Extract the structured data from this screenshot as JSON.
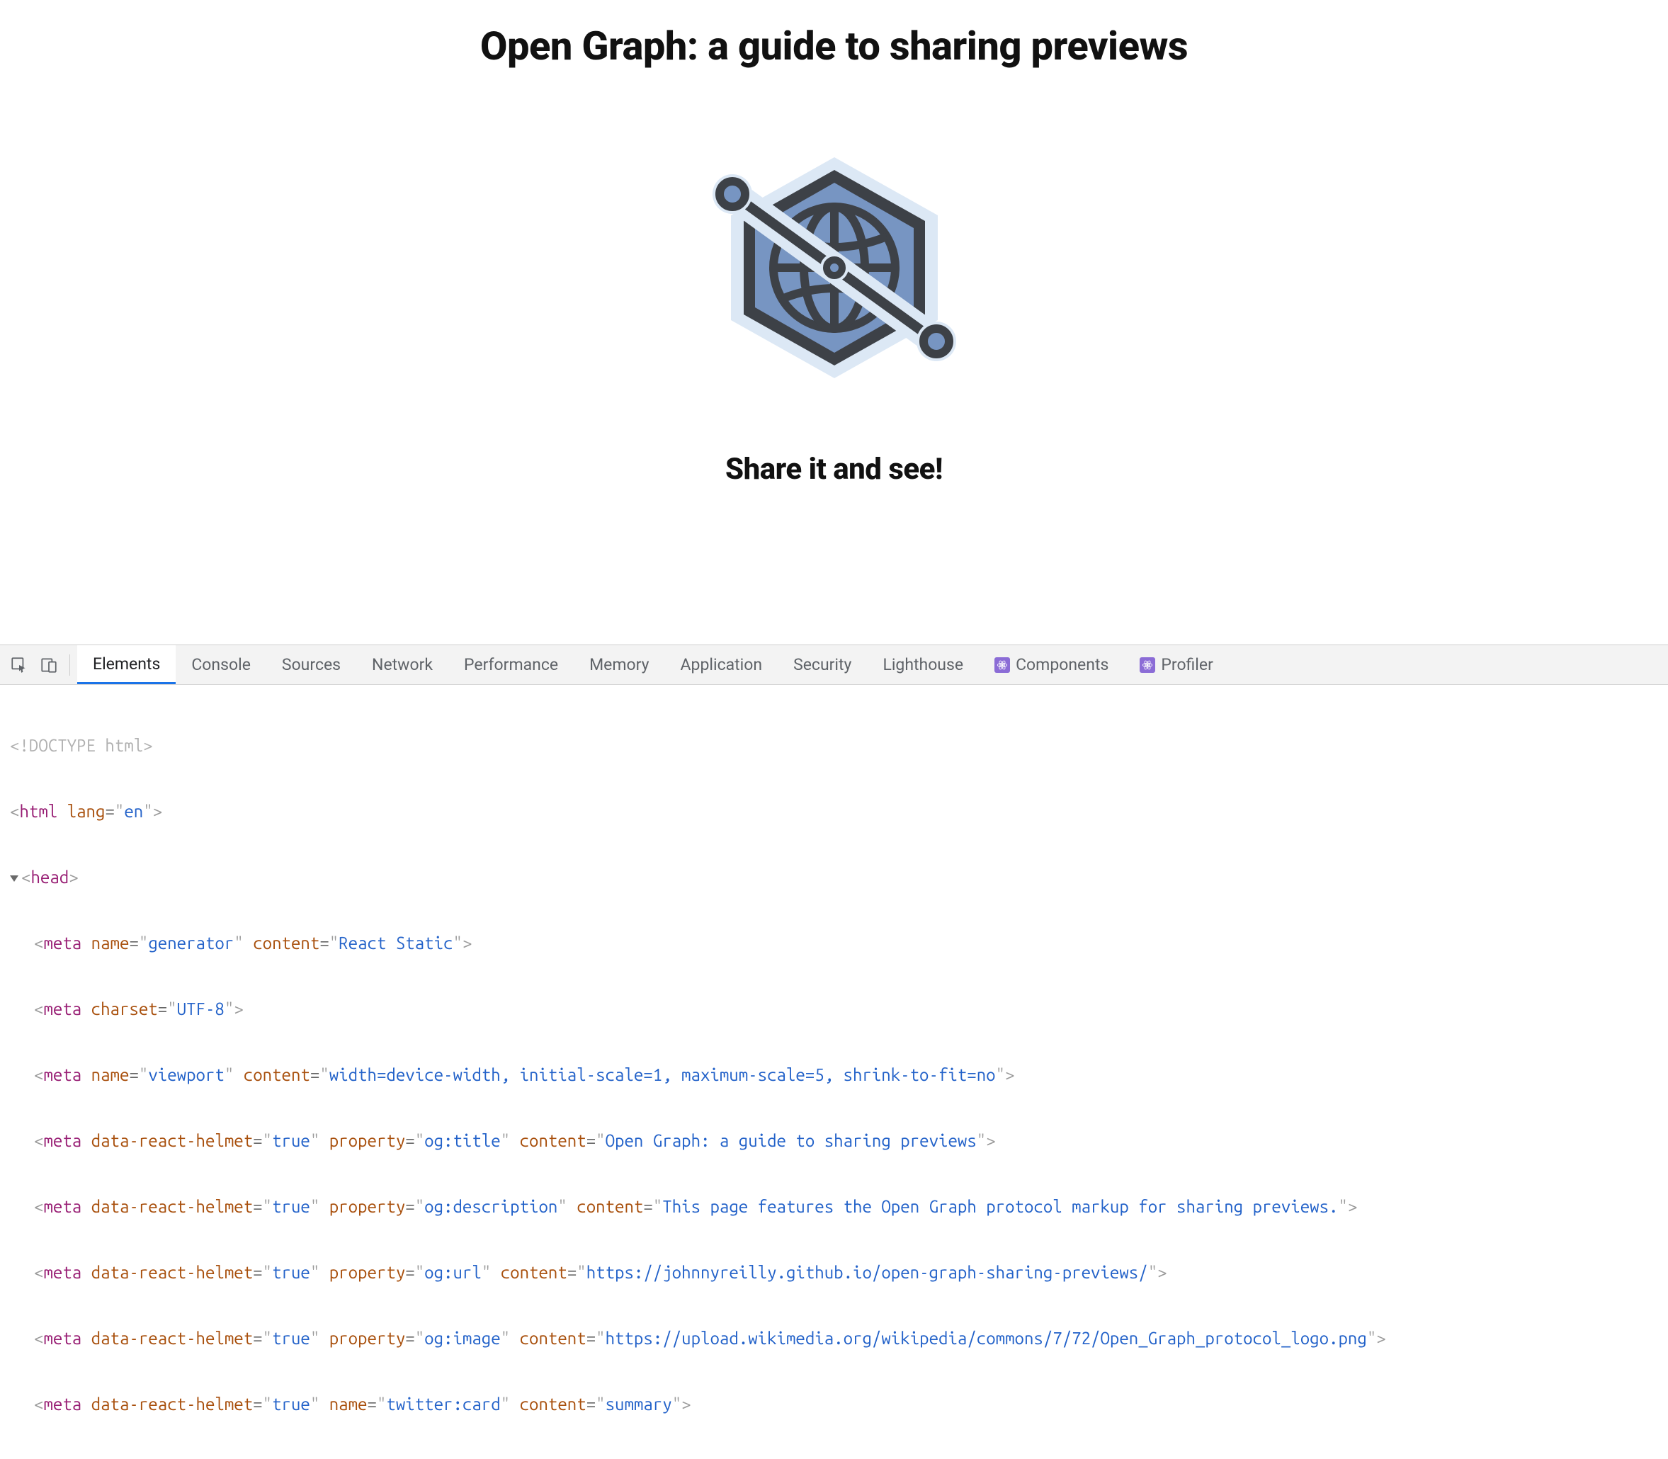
{
  "page": {
    "title": "Open Graph: a guide to sharing previews",
    "subtitle": "Share it and see!"
  },
  "devtools": {
    "tabs": [
      "Elements",
      "Console",
      "Sources",
      "Network",
      "Performance",
      "Memory",
      "Application",
      "Security",
      "Lighthouse",
      "Components",
      "Profiler"
    ],
    "active_tab": "Elements"
  },
  "dom": {
    "doctype": "<!DOCTYPE html>",
    "html_lang": "en",
    "meta": [
      {
        "kind": "name",
        "key": "generator",
        "value": "React Static"
      },
      {
        "kind": "charset",
        "value": "UTF-8"
      },
      {
        "kind": "name",
        "key": "viewport",
        "value": "width=device-width, initial-scale=1, maximum-scale=5, shrink-to-fit=no"
      },
      {
        "kind": "helmet-property",
        "key": "og:title",
        "value": "Open Graph: a guide to sharing previews"
      },
      {
        "kind": "helmet-property",
        "key": "og:description",
        "value": "This page features the Open Graph protocol markup for sharing previews."
      },
      {
        "kind": "helmet-property",
        "key": "og:url",
        "value": "https://johnnyreilly.github.io/open-graph-sharing-previews/"
      },
      {
        "kind": "helmet-property",
        "key": "og:image",
        "value": "https://upload.wikimedia.org/wikipedia/commons/7/72/Open_Graph_protocol_logo.png"
      },
      {
        "kind": "helmet-name",
        "key": "twitter:card",
        "value": "summary"
      }
    ]
  }
}
